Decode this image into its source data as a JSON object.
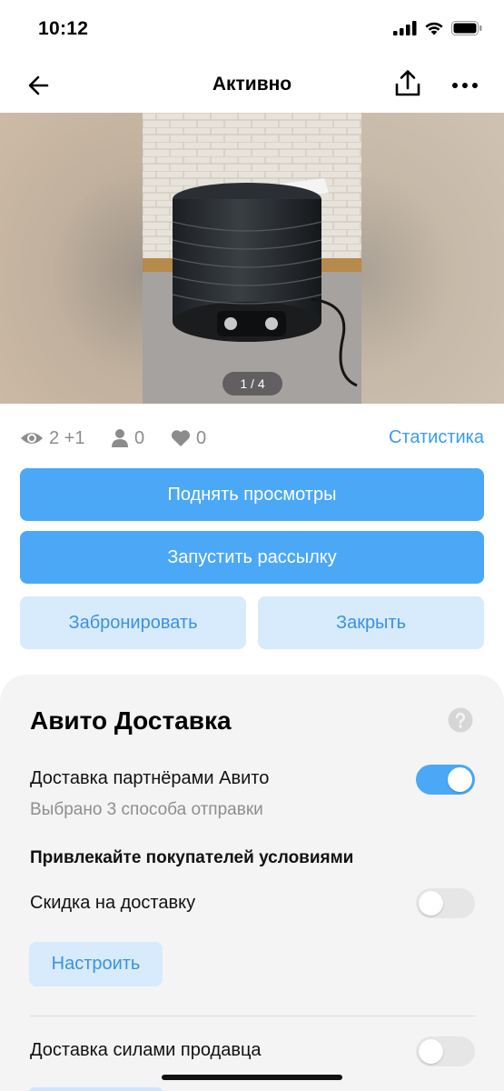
{
  "status_bar": {
    "time": "10:12"
  },
  "nav": {
    "title": "Активно"
  },
  "gallery": {
    "counter": "1 / 4"
  },
  "stats": {
    "views": "2 +1",
    "contacts": "0",
    "favorites": "0",
    "link": "Статистика"
  },
  "actions": {
    "boost": "Поднять просмотры",
    "mailing": "Запустить рассылку",
    "reserve": "Забронировать",
    "close": "Закрыть"
  },
  "delivery": {
    "title": "Авито Доставка",
    "partner_label": "Доставка партнёрами Авито",
    "partner_enabled": true,
    "partner_sub": "Выбрано 3 способа отправки",
    "attract_heading": "Привлекайте покупателей условиями",
    "discount_label": "Скидка на доставку",
    "discount_enabled": false,
    "configure": "Настроить",
    "seller_label": "Доставка силами продавца",
    "seller_enabled": false
  },
  "colors": {
    "accent": "#4aa8f7",
    "accent_light": "#d8ebfc",
    "link": "#3a9bf0",
    "muted": "#8c8c8c"
  }
}
